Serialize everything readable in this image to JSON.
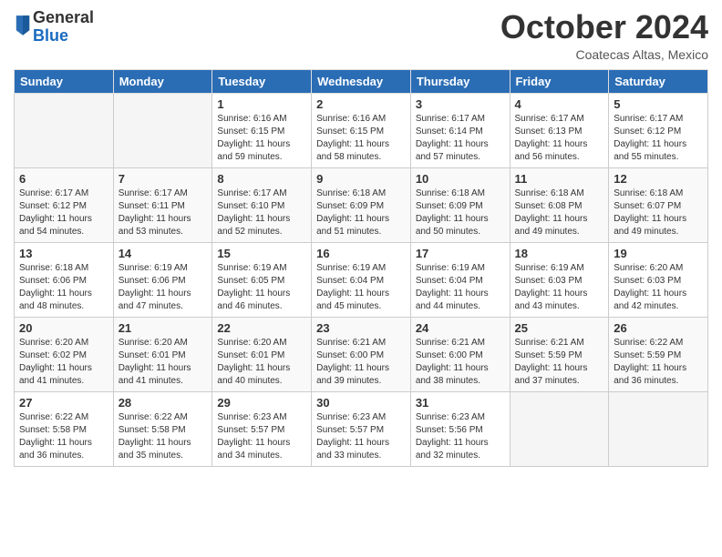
{
  "header": {
    "logo_general": "General",
    "logo_blue": "Blue",
    "month": "October 2024",
    "location": "Coatecas Altas, Mexico"
  },
  "days_of_week": [
    "Sunday",
    "Monday",
    "Tuesday",
    "Wednesday",
    "Thursday",
    "Friday",
    "Saturday"
  ],
  "weeks": [
    [
      {
        "day": "",
        "empty": true
      },
      {
        "day": "",
        "empty": true
      },
      {
        "day": "1",
        "sunrise": "Sunrise: 6:16 AM",
        "sunset": "Sunset: 6:15 PM",
        "daylight": "Daylight: 11 hours and 59 minutes."
      },
      {
        "day": "2",
        "sunrise": "Sunrise: 6:16 AM",
        "sunset": "Sunset: 6:15 PM",
        "daylight": "Daylight: 11 hours and 58 minutes."
      },
      {
        "day": "3",
        "sunrise": "Sunrise: 6:17 AM",
        "sunset": "Sunset: 6:14 PM",
        "daylight": "Daylight: 11 hours and 57 minutes."
      },
      {
        "day": "4",
        "sunrise": "Sunrise: 6:17 AM",
        "sunset": "Sunset: 6:13 PM",
        "daylight": "Daylight: 11 hours and 56 minutes."
      },
      {
        "day": "5",
        "sunrise": "Sunrise: 6:17 AM",
        "sunset": "Sunset: 6:12 PM",
        "daylight": "Daylight: 11 hours and 55 minutes."
      }
    ],
    [
      {
        "day": "6",
        "sunrise": "Sunrise: 6:17 AM",
        "sunset": "Sunset: 6:12 PM",
        "daylight": "Daylight: 11 hours and 54 minutes."
      },
      {
        "day": "7",
        "sunrise": "Sunrise: 6:17 AM",
        "sunset": "Sunset: 6:11 PM",
        "daylight": "Daylight: 11 hours and 53 minutes."
      },
      {
        "day": "8",
        "sunrise": "Sunrise: 6:17 AM",
        "sunset": "Sunset: 6:10 PM",
        "daylight": "Daylight: 11 hours and 52 minutes."
      },
      {
        "day": "9",
        "sunrise": "Sunrise: 6:18 AM",
        "sunset": "Sunset: 6:09 PM",
        "daylight": "Daylight: 11 hours and 51 minutes."
      },
      {
        "day": "10",
        "sunrise": "Sunrise: 6:18 AM",
        "sunset": "Sunset: 6:09 PM",
        "daylight": "Daylight: 11 hours and 50 minutes."
      },
      {
        "day": "11",
        "sunrise": "Sunrise: 6:18 AM",
        "sunset": "Sunset: 6:08 PM",
        "daylight": "Daylight: 11 hours and 49 minutes."
      },
      {
        "day": "12",
        "sunrise": "Sunrise: 6:18 AM",
        "sunset": "Sunset: 6:07 PM",
        "daylight": "Daylight: 11 hours and 49 minutes."
      }
    ],
    [
      {
        "day": "13",
        "sunrise": "Sunrise: 6:18 AM",
        "sunset": "Sunset: 6:06 PM",
        "daylight": "Daylight: 11 hours and 48 minutes."
      },
      {
        "day": "14",
        "sunrise": "Sunrise: 6:19 AM",
        "sunset": "Sunset: 6:06 PM",
        "daylight": "Daylight: 11 hours and 47 minutes."
      },
      {
        "day": "15",
        "sunrise": "Sunrise: 6:19 AM",
        "sunset": "Sunset: 6:05 PM",
        "daylight": "Daylight: 11 hours and 46 minutes."
      },
      {
        "day": "16",
        "sunrise": "Sunrise: 6:19 AM",
        "sunset": "Sunset: 6:04 PM",
        "daylight": "Daylight: 11 hours and 45 minutes."
      },
      {
        "day": "17",
        "sunrise": "Sunrise: 6:19 AM",
        "sunset": "Sunset: 6:04 PM",
        "daylight": "Daylight: 11 hours and 44 minutes."
      },
      {
        "day": "18",
        "sunrise": "Sunrise: 6:19 AM",
        "sunset": "Sunset: 6:03 PM",
        "daylight": "Daylight: 11 hours and 43 minutes."
      },
      {
        "day": "19",
        "sunrise": "Sunrise: 6:20 AM",
        "sunset": "Sunset: 6:03 PM",
        "daylight": "Daylight: 11 hours and 42 minutes."
      }
    ],
    [
      {
        "day": "20",
        "sunrise": "Sunrise: 6:20 AM",
        "sunset": "Sunset: 6:02 PM",
        "daylight": "Daylight: 11 hours and 41 minutes."
      },
      {
        "day": "21",
        "sunrise": "Sunrise: 6:20 AM",
        "sunset": "Sunset: 6:01 PM",
        "daylight": "Daylight: 11 hours and 41 minutes."
      },
      {
        "day": "22",
        "sunrise": "Sunrise: 6:20 AM",
        "sunset": "Sunset: 6:01 PM",
        "daylight": "Daylight: 11 hours and 40 minutes."
      },
      {
        "day": "23",
        "sunrise": "Sunrise: 6:21 AM",
        "sunset": "Sunset: 6:00 PM",
        "daylight": "Daylight: 11 hours and 39 minutes."
      },
      {
        "day": "24",
        "sunrise": "Sunrise: 6:21 AM",
        "sunset": "Sunset: 6:00 PM",
        "daylight": "Daylight: 11 hours and 38 minutes."
      },
      {
        "day": "25",
        "sunrise": "Sunrise: 6:21 AM",
        "sunset": "Sunset: 5:59 PM",
        "daylight": "Daylight: 11 hours and 37 minutes."
      },
      {
        "day": "26",
        "sunrise": "Sunrise: 6:22 AM",
        "sunset": "Sunset: 5:59 PM",
        "daylight": "Daylight: 11 hours and 36 minutes."
      }
    ],
    [
      {
        "day": "27",
        "sunrise": "Sunrise: 6:22 AM",
        "sunset": "Sunset: 5:58 PM",
        "daylight": "Daylight: 11 hours and 36 minutes."
      },
      {
        "day": "28",
        "sunrise": "Sunrise: 6:22 AM",
        "sunset": "Sunset: 5:58 PM",
        "daylight": "Daylight: 11 hours and 35 minutes."
      },
      {
        "day": "29",
        "sunrise": "Sunrise: 6:23 AM",
        "sunset": "Sunset: 5:57 PM",
        "daylight": "Daylight: 11 hours and 34 minutes."
      },
      {
        "day": "30",
        "sunrise": "Sunrise: 6:23 AM",
        "sunset": "Sunset: 5:57 PM",
        "daylight": "Daylight: 11 hours and 33 minutes."
      },
      {
        "day": "31",
        "sunrise": "Sunrise: 6:23 AM",
        "sunset": "Sunset: 5:56 PM",
        "daylight": "Daylight: 11 hours and 32 minutes."
      },
      {
        "day": "",
        "empty": true
      },
      {
        "day": "",
        "empty": true
      }
    ]
  ]
}
